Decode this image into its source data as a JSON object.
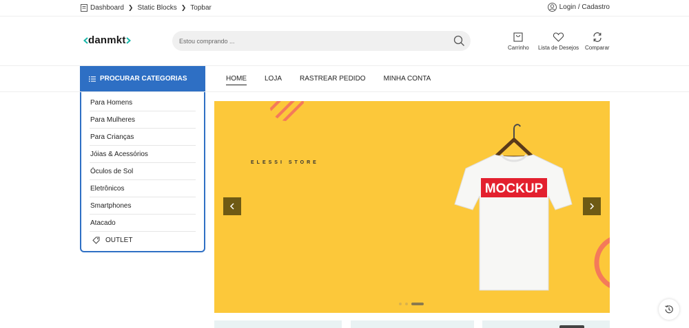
{
  "breadcrumb": {
    "items": [
      "Dashboard",
      "Static Blocks",
      "Topbar"
    ]
  },
  "login": {
    "label": "Login / Cadastro"
  },
  "logo": {
    "text": "danmkt"
  },
  "search": {
    "placeholder": "Estou comprando ..."
  },
  "header_actions": [
    {
      "label": "Carrinho",
      "icon": "cart-icon"
    },
    {
      "label": "Lista de Desejos",
      "icon": "heart-icon"
    },
    {
      "label": "Comparar",
      "icon": "compare-icon"
    }
  ],
  "categories": {
    "title": "PROCURAR CATEGORIAS",
    "items": [
      "Para Homens",
      "Para Mulheres",
      "Para Crianças",
      "Jóias & Acessórios",
      "Óculos de Sol",
      "Eletrônicos",
      "Smartphones",
      "Atacado"
    ],
    "outlet": "OUTLET"
  },
  "nav": {
    "items": [
      "HOME",
      "LOJA",
      "RASTREAR PEDIDO",
      "MINHA CONTA"
    ],
    "active": "HOME"
  },
  "hero": {
    "brand": "ELESSI STORE",
    "shirt_text": "MOCKUP",
    "background": "#fcc83a",
    "slides": 3,
    "active_slide": 3
  },
  "colors": {
    "accent": "#2e6fc4",
    "logo_bracket": "#17b6a8"
  }
}
